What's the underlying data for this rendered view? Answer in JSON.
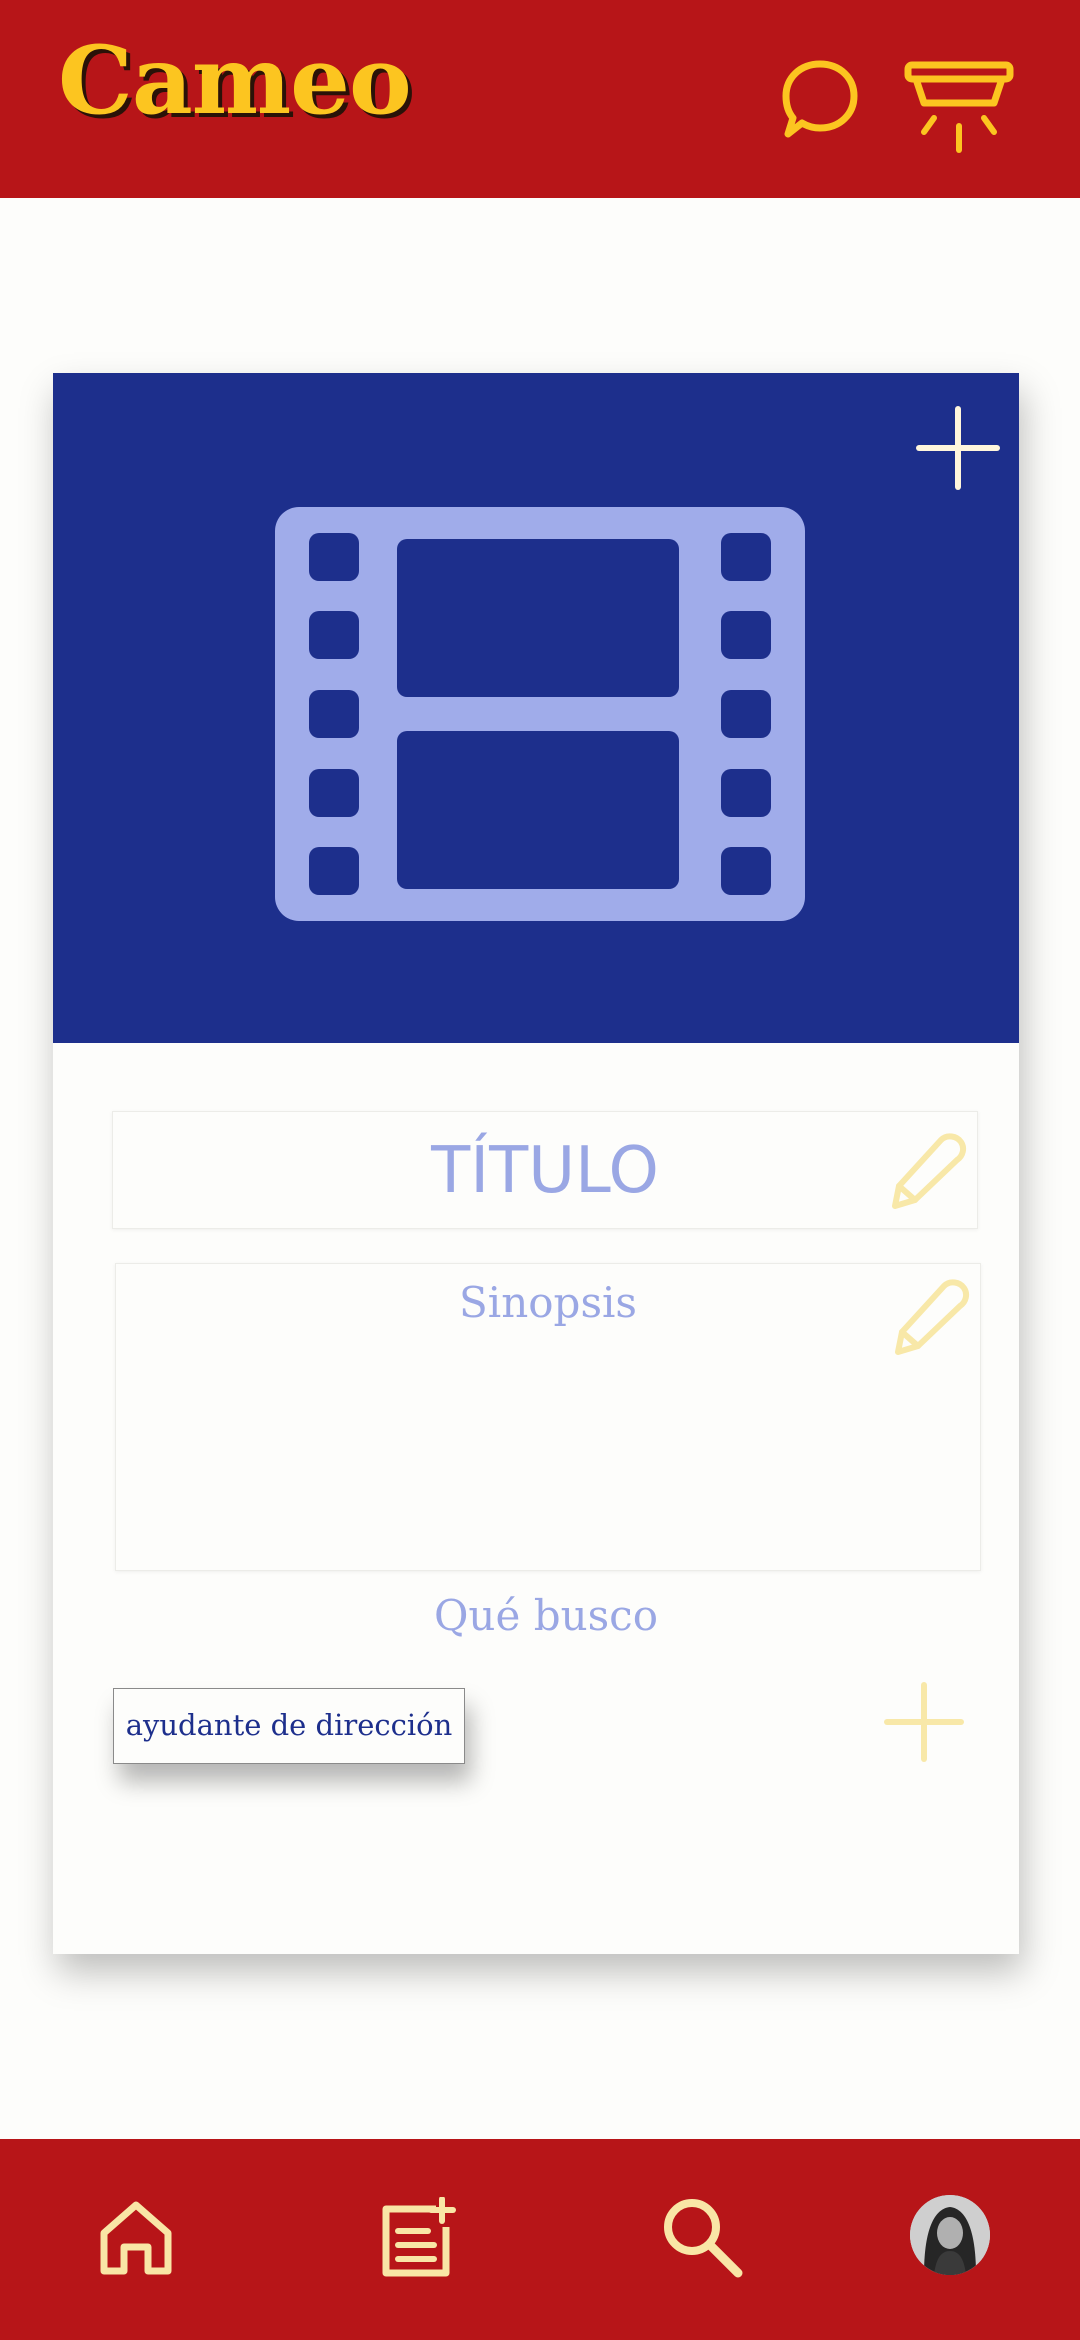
{
  "app": {
    "name": "Cameo"
  },
  "header": {
    "icons": [
      "chat-bubble-icon",
      "ceiling-lamp-icon"
    ]
  },
  "project_card": {
    "cover_icons": [
      "film-strip-icon",
      "plus-icon"
    ],
    "title_placeholder": "TÍTULO",
    "synopsis_placeholder": "Sinopsis",
    "seeking_label": "Qué busco",
    "roles": [
      "ayudante de dirección"
    ]
  },
  "bottom_nav": {
    "items": [
      "home-icon",
      "new-post-icon",
      "search-icon",
      "profile-avatar"
    ]
  },
  "colors": {
    "brand_red": "#b71518",
    "logo_yellow": "#fcc520",
    "cover_blue": "#1d2f8c",
    "icon_light_blue": "#9aa7e4",
    "pale_yellow": "#f8e8a8",
    "cream_icon": "#f9e6a6"
  }
}
